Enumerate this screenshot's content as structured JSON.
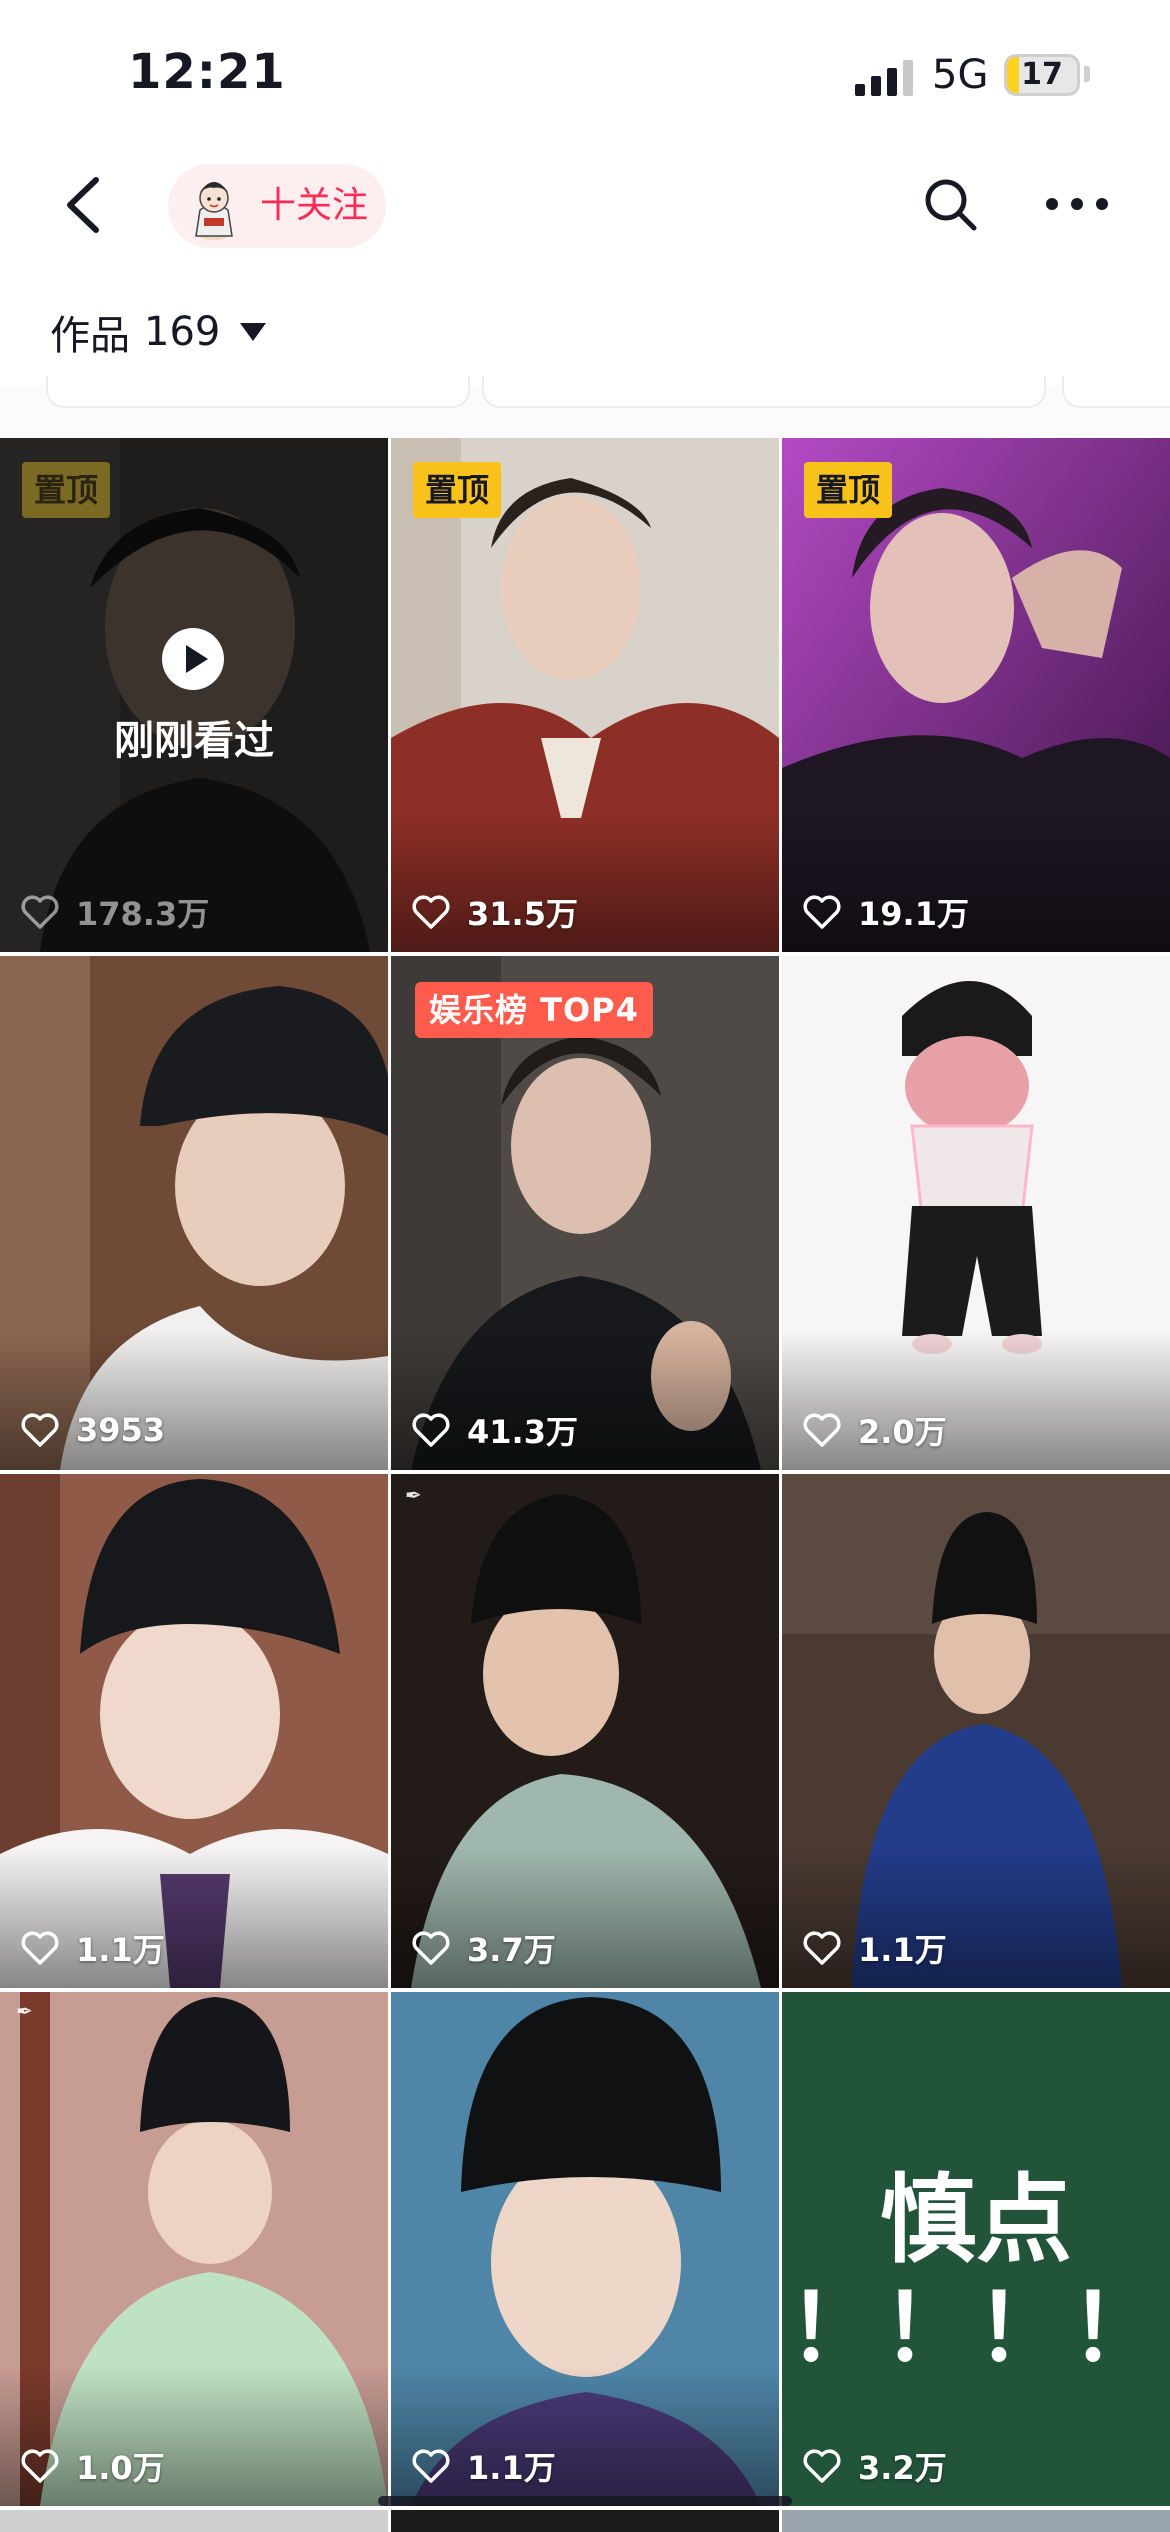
{
  "status_bar": {
    "time": "12:21",
    "network": "5G",
    "battery": "17",
    "battery_level": 0.17
  },
  "nav": {
    "follow_label": "十关注"
  },
  "works": {
    "label": "作品",
    "count": "169"
  },
  "colors": {
    "accent": "#fe2c55",
    "pinned_badge": "#f9c21b",
    "rank_badge": "#ff5c4d",
    "follow_bg": "#fdeef0"
  },
  "icons": {
    "back": "chevron-left-icon",
    "search": "search-icon",
    "more": "ellipsis-icon",
    "like": "heart-outline-icon",
    "play": "play-icon",
    "caret": "caret-down-icon"
  },
  "grid": {
    "tiles": [
      {
        "likes": "178.3万",
        "badge": "置顶",
        "overlay": "刚刚看过"
      },
      {
        "likes": "31.5万",
        "badge": "置顶"
      },
      {
        "likes": "19.1万",
        "badge": "置顶"
      },
      {
        "likes": "3953"
      },
      {
        "likes": "41.3万",
        "badge": "娱乐榜 TOP4"
      },
      {
        "likes": "2.0万"
      },
      {
        "likes": "1.1万"
      },
      {
        "likes": "3.7万"
      },
      {
        "likes": "1.1万"
      },
      {
        "likes": "1.0万"
      },
      {
        "likes": "1.1万"
      },
      {
        "likes": "3.2万",
        "text_line1": "慎点",
        "text_line2": "！！！！"
      }
    ]
  }
}
